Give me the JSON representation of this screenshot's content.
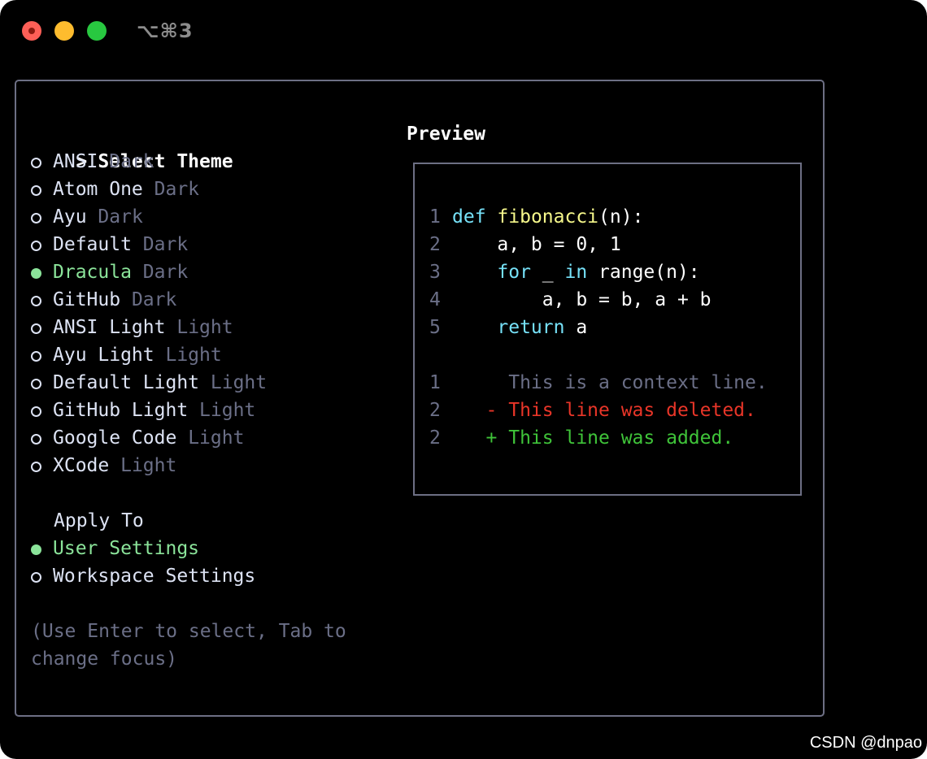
{
  "window": {
    "title": "⌥⌘3"
  },
  "theme_section": {
    "caret": ">",
    "title": "Select Theme",
    "selected_index": 4,
    "items": [
      {
        "name": "ANSI",
        "variant": "Dark"
      },
      {
        "name": "Atom One",
        "variant": "Dark"
      },
      {
        "name": "Ayu",
        "variant": "Dark"
      },
      {
        "name": "Default",
        "variant": "Dark"
      },
      {
        "name": "Dracula",
        "variant": "Dark"
      },
      {
        "name": "GitHub",
        "variant": "Dark"
      },
      {
        "name": "ANSI Light",
        "variant": "Light"
      },
      {
        "name": "Ayu Light",
        "variant": "Light"
      },
      {
        "name": "Default Light",
        "variant": "Light"
      },
      {
        "name": "GitHub Light",
        "variant": "Light"
      },
      {
        "name": "Google Code",
        "variant": "Light"
      },
      {
        "name": "XCode",
        "variant": "Light"
      }
    ]
  },
  "apply_section": {
    "title": "Apply To",
    "selected_index": 0,
    "items": [
      "User Settings",
      "Workspace Settings"
    ]
  },
  "hint": {
    "line1": "(Use Enter to select, Tab to",
    "line2": "change focus)"
  },
  "preview": {
    "title": "Preview",
    "code": [
      {
        "num": "1",
        "tokens": [
          {
            "t": "def",
            "c": "kw"
          },
          {
            "t": " ",
            "c": "plain"
          },
          {
            "t": "fibonacci",
            "c": "fn"
          },
          {
            "t": "(n):",
            "c": "plain"
          }
        ]
      },
      {
        "num": "2",
        "tokens": [
          {
            "t": "    a, b = 0, 1",
            "c": "plain"
          }
        ]
      },
      {
        "num": "3",
        "tokens": [
          {
            "t": "    ",
            "c": "plain"
          },
          {
            "t": "for",
            "c": "kw"
          },
          {
            "t": " _ ",
            "c": "plain"
          },
          {
            "t": "in",
            "c": "kw"
          },
          {
            "t": " range(n):",
            "c": "plain"
          }
        ]
      },
      {
        "num": "4",
        "tokens": [
          {
            "t": "        a, b = b, a + b",
            "c": "plain"
          }
        ]
      },
      {
        "num": "5",
        "tokens": [
          {
            "t": "    ",
            "c": "plain"
          },
          {
            "t": "return",
            "c": "kw"
          },
          {
            "t": " a",
            "c": "plain"
          }
        ]
      }
    ],
    "diff": [
      {
        "num": "1",
        "text": "     This is a context line.",
        "kind": "ctx"
      },
      {
        "num": "2",
        "text": "   - This line was deleted.",
        "kind": "del"
      },
      {
        "num": "2",
        "text": "   + This line was added.",
        "kind": "add"
      }
    ]
  },
  "watermark": "CSDN @dnpao",
  "colors": {
    "background": "#000000",
    "border": "#6d6f84",
    "selected": "#8be49a",
    "keyword": "#76e1f8",
    "function": "#f6f88b",
    "deleted": "#e83528",
    "added": "#3fc339"
  }
}
